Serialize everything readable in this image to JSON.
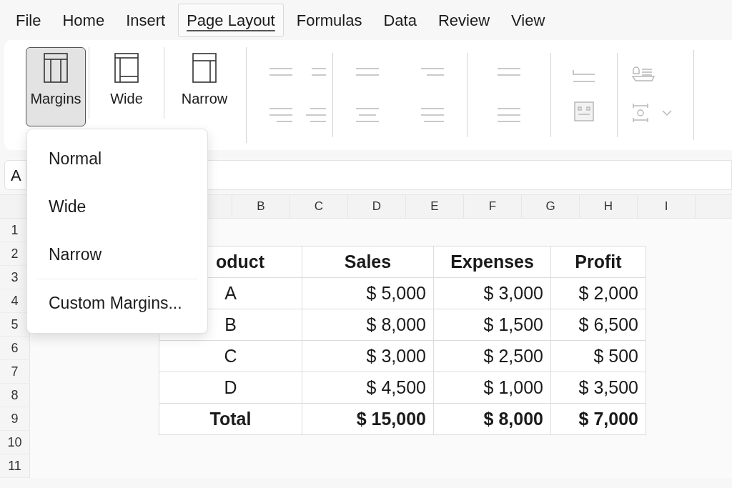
{
  "tabs": [
    {
      "label": "File",
      "selected": false
    },
    {
      "label": "Home",
      "selected": false
    },
    {
      "label": "Insert",
      "selected": false
    },
    {
      "label": "Page Layout",
      "selected": true
    },
    {
      "label": "Formulas",
      "selected": false
    },
    {
      "label": "Data",
      "selected": false
    },
    {
      "label": "Review",
      "selected": false
    },
    {
      "label": "View",
      "selected": false
    }
  ],
  "ribbon": {
    "buttons": [
      {
        "label": "Margins",
        "kind": "margins",
        "selected": true
      },
      {
        "label": "Wide",
        "kind": "wide",
        "selected": false
      },
      {
        "label": "Narrow",
        "kind": "narrow",
        "selected": false
      }
    ]
  },
  "name_box": {
    "value": "A"
  },
  "column_headers": [
    "B",
    "C",
    "D",
    "E",
    "F",
    "G",
    "H",
    "I"
  ],
  "row_headers": [
    "1",
    "2",
    "3",
    "4",
    "5",
    "6",
    "7",
    "8",
    "9",
    "10",
    "11"
  ],
  "table": {
    "columns": [
      "oduct",
      "Sales",
      "Expenses",
      "Profit"
    ],
    "rows": [
      [
        "A",
        "$ 5,000",
        "$ 3,000",
        "$ 2,000"
      ],
      [
        "B",
        "$ 8,000",
        "$ 1,500",
        "$ 6,500"
      ],
      [
        "C",
        "$ 3,000",
        "$ 2,500",
        "$ 500"
      ],
      [
        "D",
        "$ 4,500",
        "$ 1,000",
        "$ 3,500"
      ]
    ],
    "total": [
      "Total",
      "$ 15,000",
      "$ 8,000",
      "$ 7,000"
    ]
  },
  "margins_menu": {
    "items": [
      {
        "label": "Normal",
        "kind": "item"
      },
      {
        "label": "Wide",
        "kind": "item"
      },
      {
        "label": "Narrow",
        "kind": "item"
      },
      {
        "kind": "separator"
      },
      {
        "label": "Custom Margins...",
        "kind": "item"
      }
    ]
  }
}
